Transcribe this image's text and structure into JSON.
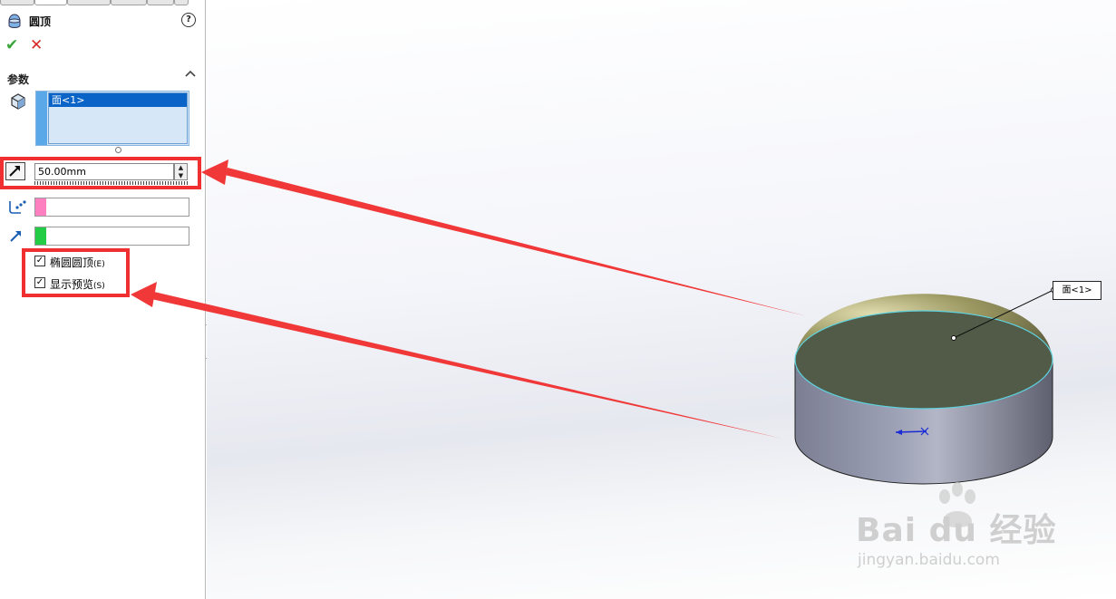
{
  "panel": {
    "title": "圆顶",
    "help": "?",
    "ok_icon": "✔",
    "cancel_icon": "✕",
    "section_title": "参数",
    "section_toggle": "^",
    "face_selection": "面<1>",
    "distance_value": "50.00mm",
    "checkbox_elliptical": {
      "label": "椭圆圆顶",
      "key": "(E)",
      "checked": true
    },
    "checkbox_preview": {
      "label": "显示预览",
      "key": "(S)",
      "checked": true
    }
  },
  "viewport": {
    "callout_label": "面<1>"
  },
  "watermark": {
    "brand": "Bai du 经验",
    "url": "jingyan.baidu.com"
  },
  "colors": {
    "annotation_red": "#f03030",
    "selection_blue": "#0a64c8",
    "vertex_pink": "#ff80c0",
    "direction_green": "#22cc44"
  }
}
